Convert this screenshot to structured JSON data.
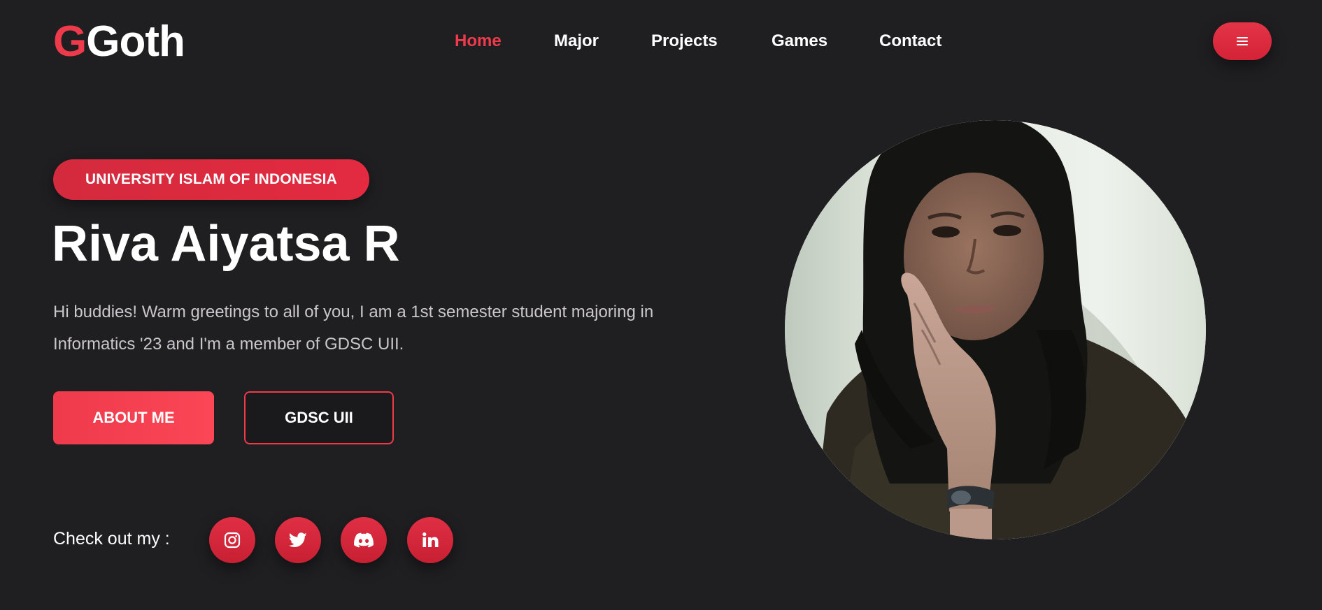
{
  "header": {
    "logo_accent": "G",
    "logo_rest": "Goth",
    "nav": {
      "home": "Home",
      "major": "Major",
      "projects": "Projects",
      "games": "Games",
      "contact": "Contact"
    },
    "active_nav": "Home",
    "menu_icon": "hamburger-icon"
  },
  "hero": {
    "badge": "UNIVERSITY ISLAM OF INDONESIA",
    "name": "Riva Aiyatsa R",
    "bio_line1": "Hi buddies! Warm greetings to all of you, I am a 1st semester student majoring in",
    "bio_line2": "Informatics '23 and I'm a member of GDSC UII.",
    "about_button": "ABOUT ME",
    "gdsc_button": "GDSC UII",
    "checkout_label": "Check out my :",
    "socials": [
      "instagram-icon",
      "twitter-icon",
      "discord-icon",
      "linkedin-icon"
    ]
  },
  "colors": {
    "background": "#1f1e21",
    "accent": "#ee3a4b",
    "text": "#ffffff",
    "muted_text": "#c9c7cc"
  }
}
